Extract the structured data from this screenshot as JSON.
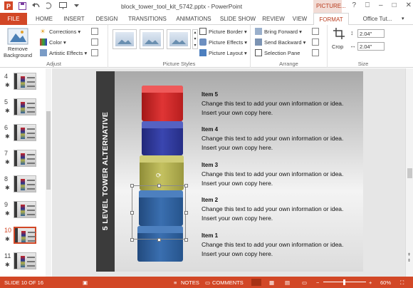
{
  "titlebar": {
    "title": "block_tower_tool_kit_5742.pptx - PowerPoint",
    "context_tab": "PICTURE...",
    "window_buttons": [
      "?",
      "⎕",
      "–",
      "□",
      "✕"
    ]
  },
  "tabs": [
    "FILE",
    "HOME",
    "INSERT",
    "DESIGN",
    "TRANSITIONS",
    "ANIMATIONS",
    "SLIDE SHOW",
    "REVIEW",
    "VIEW",
    "FORMAT",
    "Office Tut..."
  ],
  "ribbon": {
    "remove_background": "Remove Background",
    "adjust": {
      "corrections": "Corrections ▾",
      "color": "Color ▾",
      "artistic": "Artistic Effects ▾",
      "label": "Adjust"
    },
    "picture_styles": {
      "label": "Picture Styles",
      "border": "Picture Border ▾",
      "effects": "Picture Effects ▾",
      "layout": "Picture Layout ▾"
    },
    "arrange": {
      "label": "Arrange",
      "forward": "Bring Forward ▾",
      "backward": "Send Backward ▾",
      "pane": "Selection Pane"
    },
    "size": {
      "label": "Size",
      "crop": "Crop",
      "height": "2.04\"",
      "width": "2.04\""
    }
  },
  "thumbnails": [
    "4",
    "5",
    "6",
    "7",
    "8",
    "9",
    "10",
    "11"
  ],
  "active_thumbnail": "10",
  "slide": {
    "vertical_title": "5 LEVEL TOWER ALTERNATIVE",
    "items": [
      {
        "title": "Item 5",
        "body": "Change this text to add your own information or idea.  Insert your own copy here."
      },
      {
        "title": "Item 4",
        "body": "Change this text to add your own information or idea. Insert your own copy here."
      },
      {
        "title": "Item 3",
        "body": "Change this text to add your own information or idea. Insert your own copy here."
      },
      {
        "title": "Item 2",
        "body": "Change this text to add your own information or idea. Insert your own copy here."
      },
      {
        "title": "Item 1",
        "body": "Change this text to add your own information or idea. Insert your own copy here."
      }
    ],
    "colors": {
      "red": "#d42a2a",
      "blue": "#2f3a9a",
      "olive": "#b7b44e",
      "steel": "#2f5f9a",
      "steel2": "#2e5c98"
    }
  },
  "status": {
    "slide": "SLIDE 10 OF 16",
    "notes": "NOTES",
    "comments": "COMMENTS",
    "zoom": "60%"
  }
}
